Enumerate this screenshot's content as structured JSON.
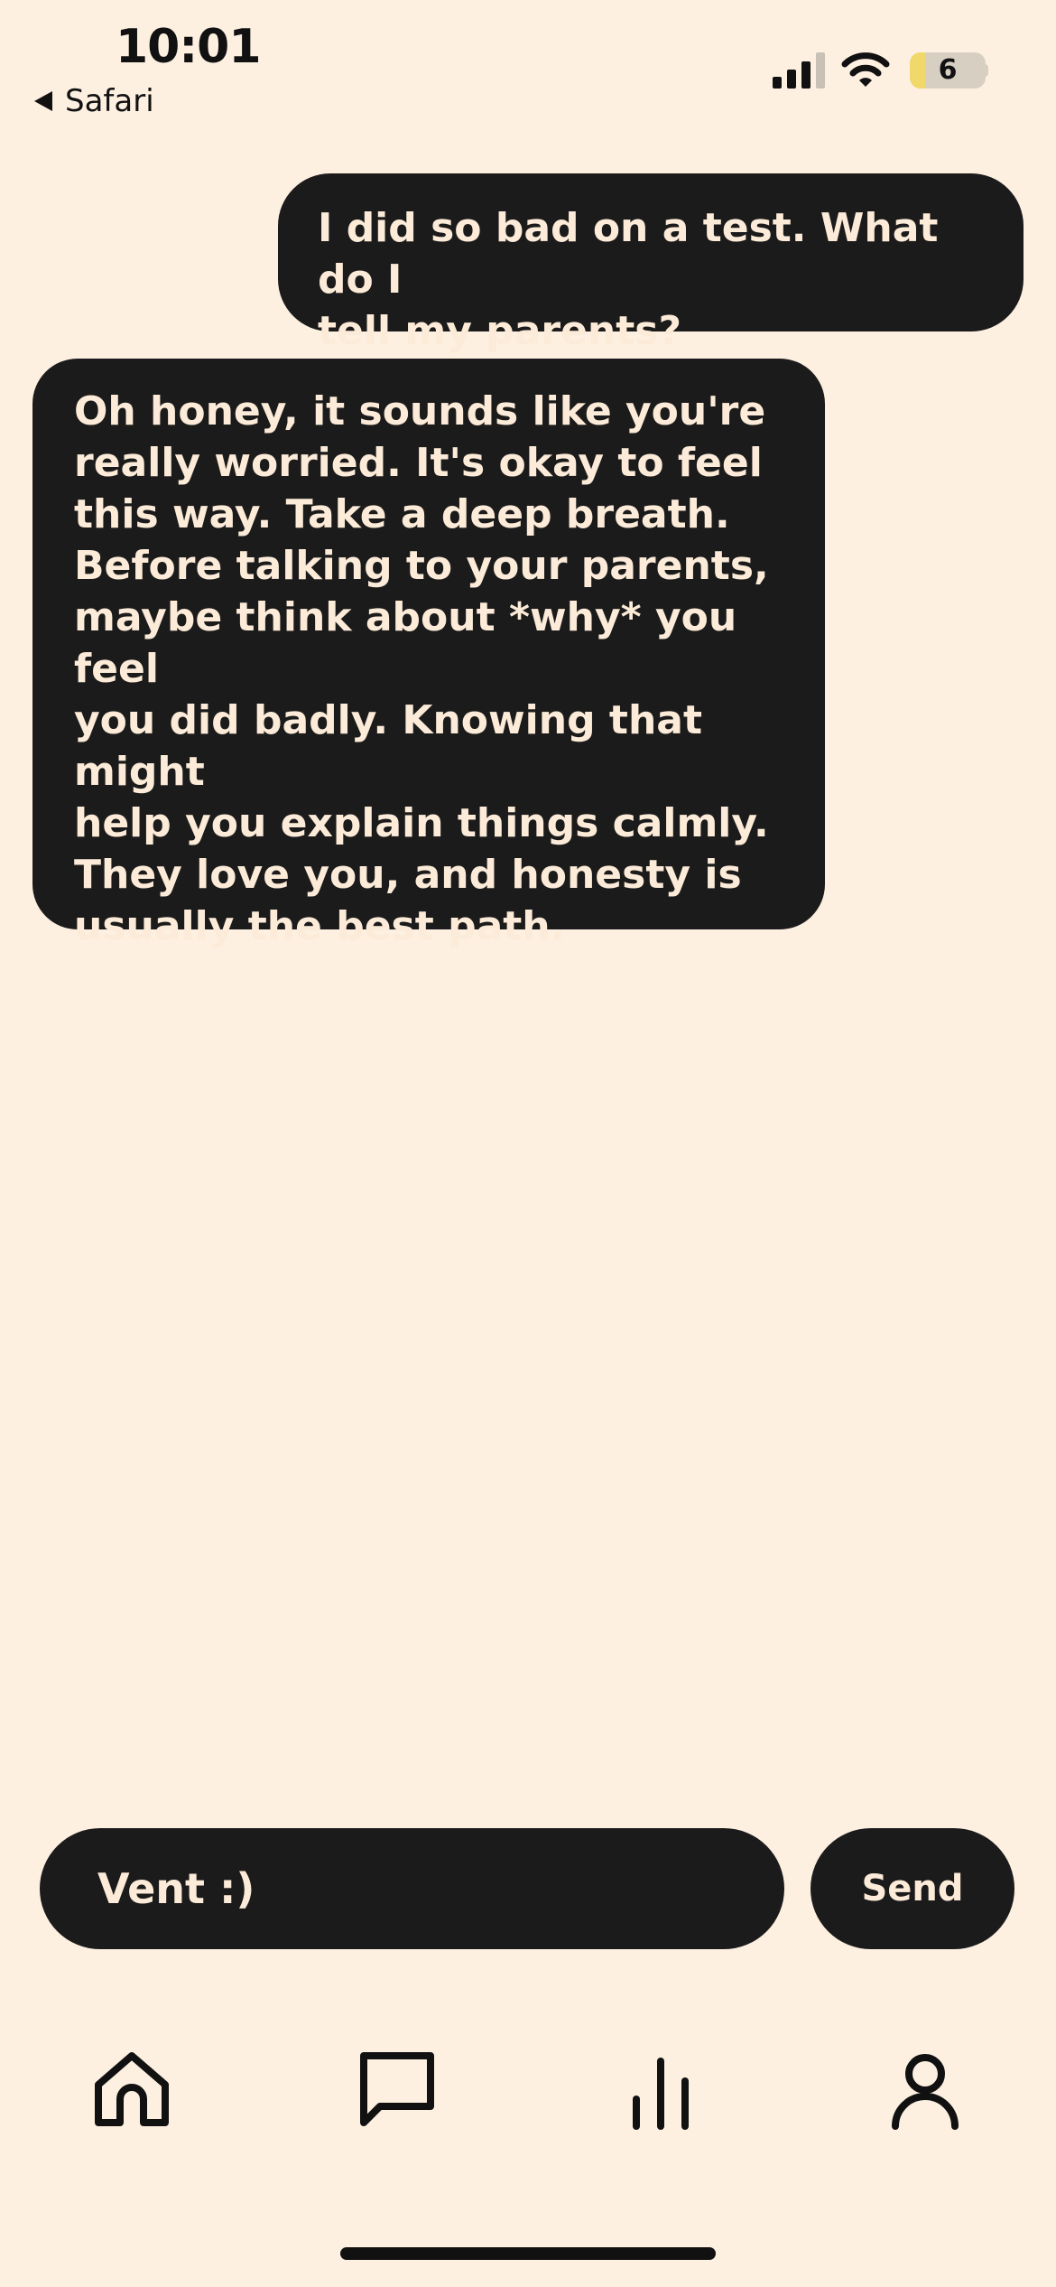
{
  "status_bar": {
    "time": "10:01",
    "back_app": "Safari",
    "battery_level": "6",
    "battery_fraction": 0.06,
    "signal_icon": "cellular-signal-icon",
    "wifi_icon": "wifi-icon"
  },
  "messages": [
    {
      "role": "user",
      "text": "I did so bad on a test. What do I\ntell my parents?"
    },
    {
      "role": "assistant",
      "text": "Oh honey, it sounds like you're\nreally worried. It's okay to feel\nthis way. Take a deep breath.\nBefore talking to your parents,\nmaybe think about *why* you feel\nyou did badly. Knowing that might\nhelp you explain things calmly.\nThey love you, and honesty is\nusually the best path."
    }
  ],
  "composer": {
    "placeholder": "Vent :)",
    "send_label": "Send"
  },
  "tab_bar": [
    {
      "icon": "home-icon"
    },
    {
      "icon": "chat-bubble-icon"
    },
    {
      "icon": "stats-bars-icon"
    },
    {
      "icon": "profile-icon"
    }
  ],
  "colors": {
    "background": "#FDF0E1",
    "bubble": "#1C1B1B",
    "bubble_text": "#FBEBD8",
    "battery_fill": "#F1D86A"
  }
}
